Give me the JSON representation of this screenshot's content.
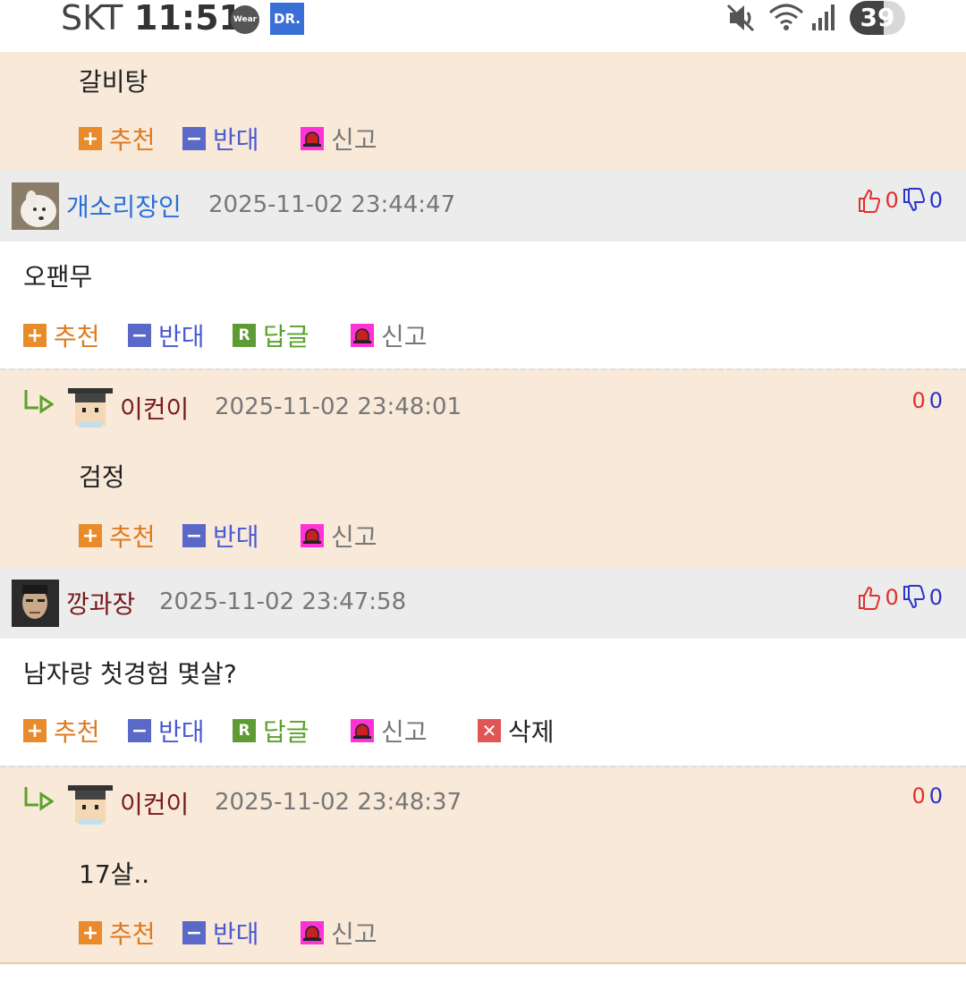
{
  "status_bar": {
    "carrier": "SKT",
    "time": "11:51",
    "wear_label": "Wear",
    "app_badge": "DR.",
    "battery": "39"
  },
  "labels": {
    "recommend": "추천",
    "oppose": "반대",
    "reply": "답글",
    "report": "신고",
    "delete": "삭제"
  },
  "top_reply": {
    "text": "갈비탕"
  },
  "comment1": {
    "author": "개소리장인",
    "date": "2025-11-02 23:44:47",
    "up": "0",
    "down": "0",
    "text": "오팬무"
  },
  "reply1": {
    "author": "이컨이",
    "date": "2025-11-02 23:48:01",
    "up": "0",
    "down": "0",
    "text": "검정"
  },
  "comment2": {
    "author": "깡과장",
    "date": "2025-11-02 23:47:58",
    "up": "0",
    "down": "0",
    "text": "남자랑 첫경험 몇살?"
  },
  "reply2": {
    "author": "이컨이",
    "date": "2025-11-02 23:48:37",
    "up": "0",
    "down": "0",
    "text": "17살.."
  },
  "colors": {
    "peach": "#f8e9d9",
    "gray": "#ececec",
    "recommend": "#e07a1f",
    "oppose": "#4a5ad0",
    "reply": "#5aa22a",
    "report_icon": "#ff32d6",
    "delete_icon": "#e05555",
    "author_blue": "#2a6fd6",
    "author_dark": "#7a1a1a",
    "vote_up": "#e0302a",
    "vote_down": "#2a34c9"
  }
}
